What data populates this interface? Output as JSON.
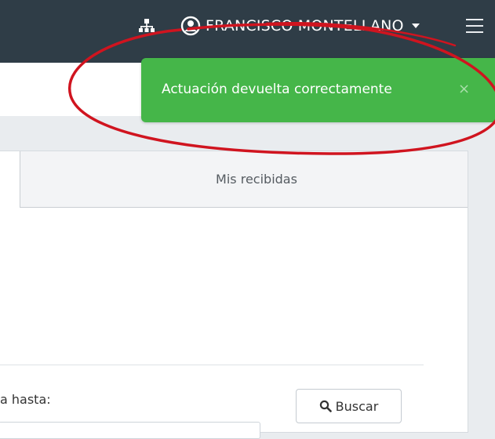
{
  "navbar": {
    "user_name": "FRANCISCO MONTELLANO"
  },
  "tabs": {
    "received_label": "Mis recibidas"
  },
  "filter": {
    "date_to_label": "a hasta:"
  },
  "search_button": {
    "label": "Buscar"
  },
  "toast": {
    "message": "Actuación devuelta correctamente",
    "close_symbol": "×"
  },
  "colors": {
    "navbar": "#2f3d47",
    "toast": "#45b649",
    "annotation": "#d0141f"
  }
}
